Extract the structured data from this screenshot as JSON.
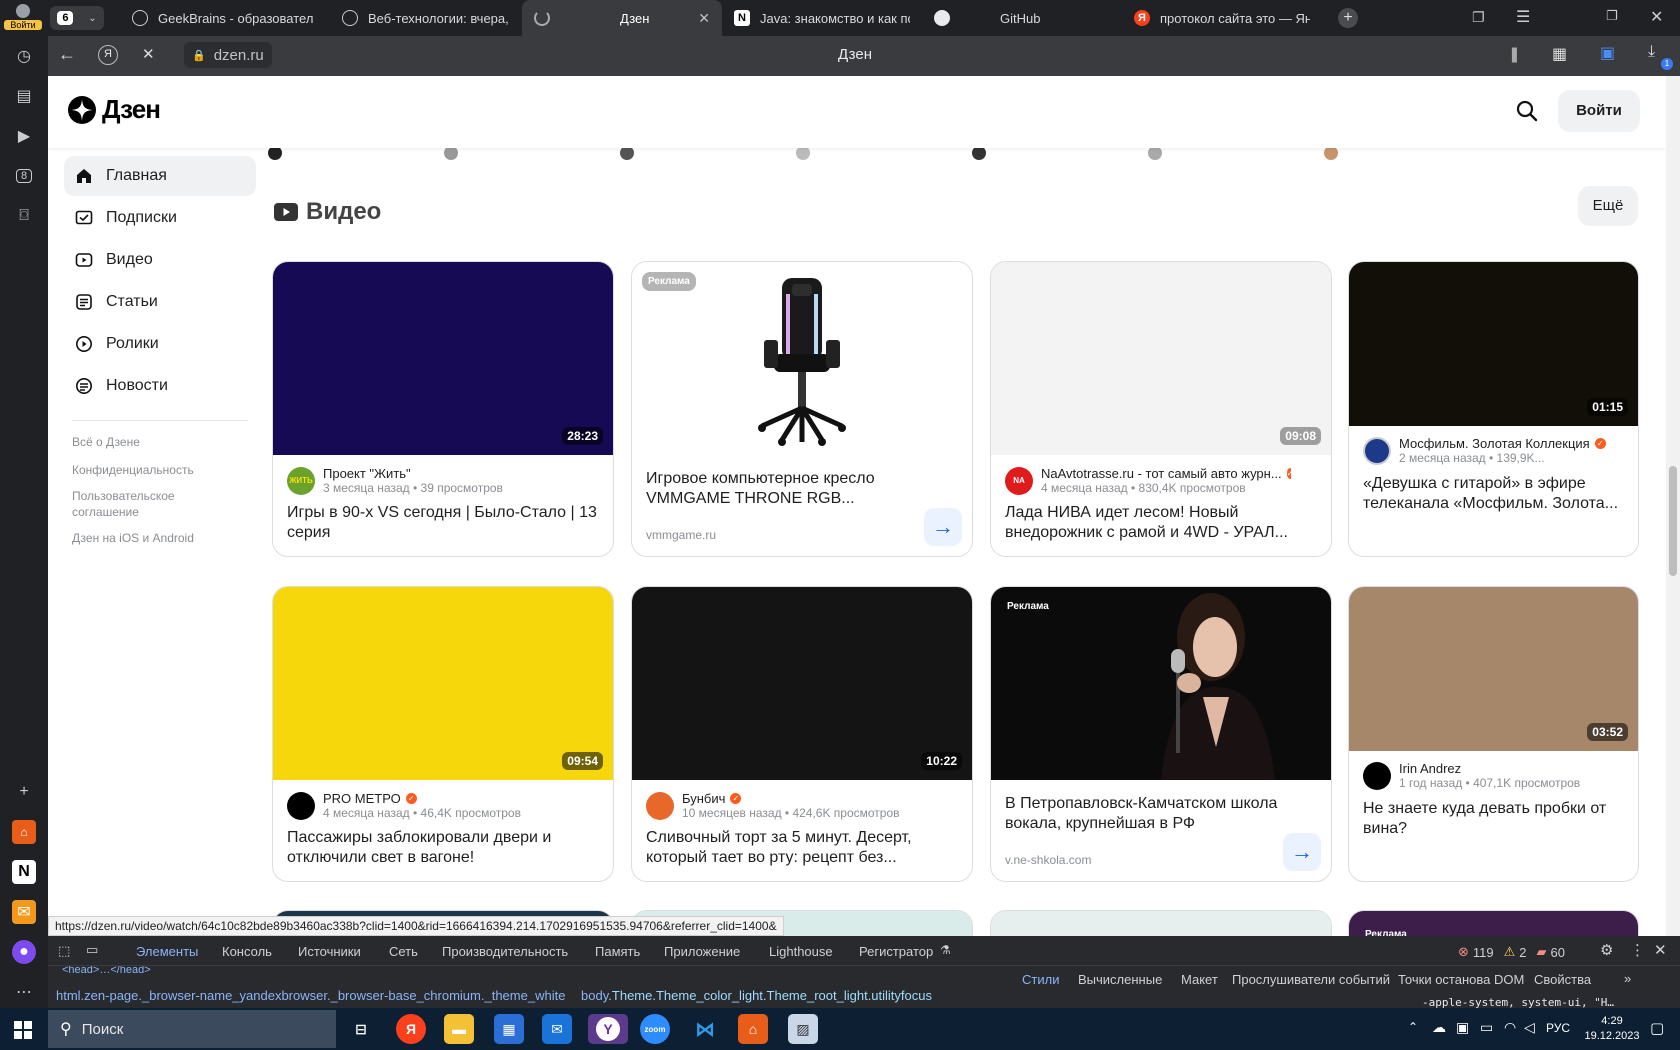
{
  "browser": {
    "tab_count": "6",
    "login_label": "Войти",
    "tabs": [
      {
        "title": "GeekBrains - образовател"
      },
      {
        "title": "Веб-технологии: вчера, се"
      },
      {
        "title": "Дзен"
      },
      {
        "title": "Java: знакомство и как по"
      },
      {
        "title": "GitHub"
      },
      {
        "title": "протокол сайта это — Янд"
      }
    ],
    "address": "dzen.ru",
    "page_title": "Дзен",
    "downloads_badge": "1",
    "status_url": "https://dzen.ru/video/watch/64c10c82bde89b3460ac338b?clid=1400&rid=1666416394.214.1702916951535.94706&referrer_clid=1400&"
  },
  "header": {
    "logo": "Дзен",
    "login_button": "Войти"
  },
  "sidebar": {
    "items": [
      {
        "label": "Главная"
      },
      {
        "label": "Подписки"
      },
      {
        "label": "Видео"
      },
      {
        "label": "Статьи"
      },
      {
        "label": "Ролики"
      },
      {
        "label": "Новости"
      }
    ],
    "footer": [
      {
        "label": "Всё о Дзене"
      },
      {
        "label": "Конфиденциальность"
      },
      {
        "label": "Пользовательское соглашение"
      },
      {
        "label": "Дзен на iOS и Android"
      }
    ]
  },
  "section": {
    "title": "Видео",
    "more_button": "Ещё"
  },
  "cards": [
    {
      "duration": "28:23",
      "channel": "Проект \"Жить\"",
      "meta": "3 месяца назад • 39 просмотров",
      "title": "Игры в 90-х VS сегодня | Было-Стало | 13 серия",
      "avatar_text": "ЖИТЬ"
    },
    {
      "ad_badge": "Реклама",
      "title": "Игровое компьютерное кресло VMMGAME THRONE RGB...",
      "domain": "vmmgame.ru"
    },
    {
      "duration": "09:08",
      "channel": "NaAvtotrasse.ru - тот самый авто журн...",
      "meta": "4 месяца назад • 830,4K просмотров",
      "title": "Лада НИВА идет лесом! Новый внедорожник с рамой и 4WD - УРАЛ...",
      "avatar_text": "NA"
    },
    {
      "duration": "01:15",
      "channel": "Мосфильм. Золотая Коллекция",
      "meta": "2 месяца назад • 139,9K...",
      "title": "«Девушка с гитарой» в эфире телеканала «Мосфильм. Золота..."
    },
    {
      "duration": "09:54",
      "channel": "PRO МЕТРО",
      "meta": "4 месяца назад • 46,4K просмотров",
      "title": "Пассажиры заблокировали двери и отключили свет в вагоне!"
    },
    {
      "duration": "10:22",
      "channel": "Бунбич",
      "meta": "10 месяцев назад • 424,6K просмотров",
      "title": "Сливочный торт за 5 минут. Десерт, который тает во рту: рецепт без..."
    },
    {
      "ad_badge": "Реклама",
      "title": "В Петропавловск-Камчатском школа вокала, крупнейшая в РФ",
      "domain": "v.ne-shkola.com"
    },
    {
      "duration": "03:52",
      "channel": "Irin Andrez",
      "meta": "1 год назад • 407,1K просмотров",
      "title": "Не знаете куда девать пробки от вина?"
    }
  ],
  "bottom_ad_badge": "Реклама",
  "devtools": {
    "tabs": [
      "Элементы",
      "Консоль",
      "Источники",
      "Сеть",
      "Производительность",
      "Память",
      "Приложение",
      "Lighthouse",
      "Регистратор"
    ],
    "errors": "119",
    "warnings": "2",
    "issues": "60",
    "breadcrumb_html": "html.zen-page._browser-name_yandexbrowser._browser-base_chromium._theme_white",
    "breadcrumb_body_tag": "body",
    "breadcrumb_body_classes": ".Theme.Theme_color_light.Theme_root_light.utilityfocus",
    "code_snippet": "<head>…</head>",
    "style_tabs": [
      "Стили",
      "Вычисленные",
      "Макет",
      "Прослушиватели событий",
      "Точки останова DOM",
      "Свойства"
    ],
    "style_snippet": "-apple-system, system-ui, \"H…"
  },
  "taskbar": {
    "search_placeholder": "Поиск",
    "time": "4:29",
    "date": "19.12.2023",
    "language": "РУС"
  }
}
